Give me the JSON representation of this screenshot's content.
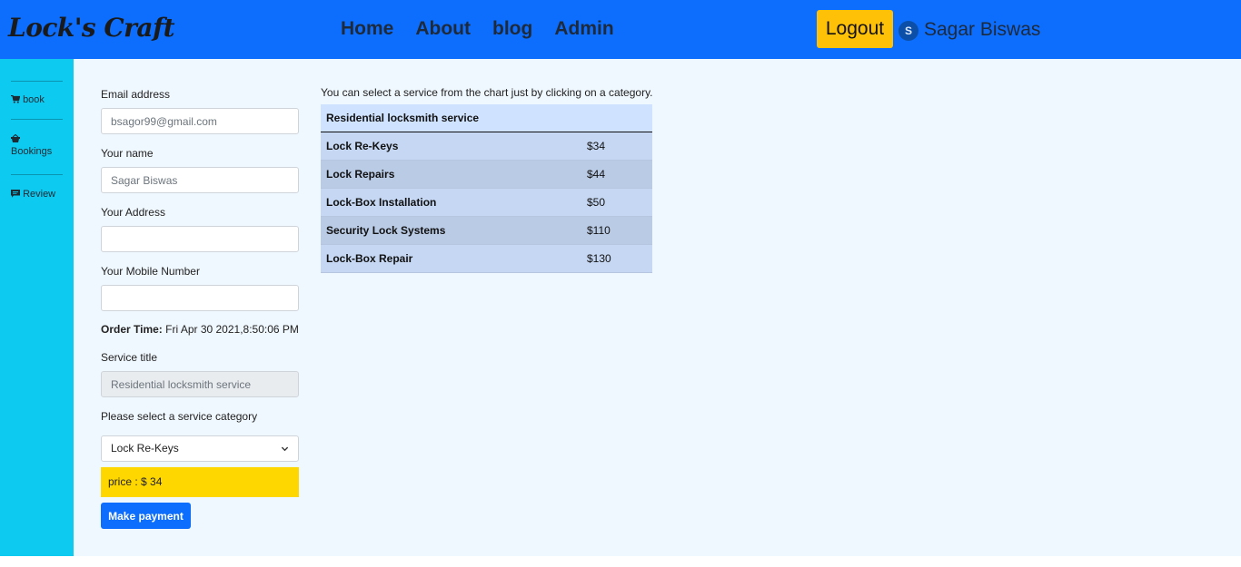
{
  "header": {
    "brand": "Lock's Craft",
    "nav": [
      "Home",
      "About",
      "blog",
      "Admin"
    ],
    "logout_label": "Logout",
    "avatar_initial": "S",
    "username": "Sagar Biswas"
  },
  "sidebar": {
    "items": [
      {
        "label": "book",
        "icon": "cart-icon"
      },
      {
        "label": "Bookings",
        "icon": "basket-icon"
      },
      {
        "label": "Review",
        "icon": "comment-icon"
      }
    ]
  },
  "form": {
    "email_label": "Email address",
    "email_placeholder": "bsagor99@gmail.com",
    "name_label": "Your name",
    "name_placeholder": "Sagar Biswas",
    "address_label": "Your Address",
    "address_value": "",
    "mobile_label": "Your Mobile Number",
    "mobile_value": "",
    "order_time_label": "Order Time:",
    "order_time_value": "Fri Apr 30 2021,8:50:06 PM",
    "service_title_label": "Service title",
    "service_title_placeholder": "Residential locksmith service",
    "category_label": "Please select a service category",
    "category_selected": "Lock Re-Keys",
    "price_text": "price : $ 34",
    "pay_label": "Make payment"
  },
  "services": {
    "hint": "You can select a service from the chart just by clicking on a category.",
    "table_title": "Residential locksmith service",
    "rows": [
      {
        "name": "Lock Re-Keys",
        "price": "$34"
      },
      {
        "name": "Lock Repairs",
        "price": "$44"
      },
      {
        "name": "Lock-Box Installation",
        "price": "$50"
      },
      {
        "name": "Security Lock Systems",
        "price": "$110"
      },
      {
        "name": "Lock-Box Repair",
        "price": "$130"
      }
    ]
  },
  "colors": {
    "header_bg": "#0d6efd",
    "sidebar_bg": "#0dcaf0",
    "main_bg": "#f0f8ff",
    "logout_bg": "#ffc107",
    "price_bg": "#ffd700"
  }
}
